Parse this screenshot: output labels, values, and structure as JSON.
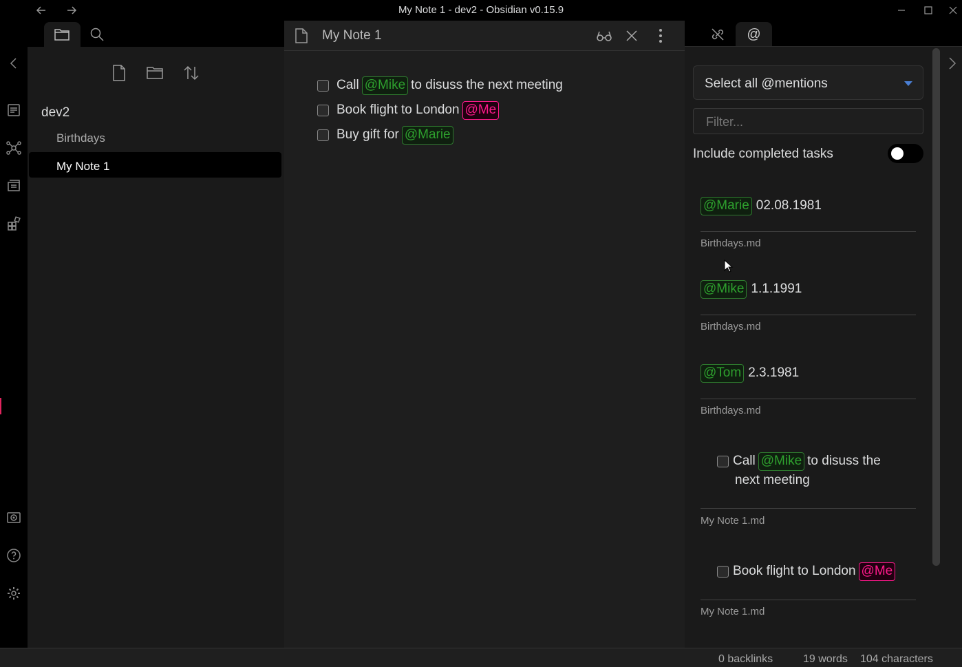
{
  "window": {
    "title": "My Note 1 - dev2 - Obsidian v0.15.9"
  },
  "left_sidebar": {
    "vault": "dev2",
    "items": [
      {
        "label": "Birthdays"
      },
      {
        "label": "My Note 1"
      }
    ]
  },
  "editor": {
    "title": "My Note 1",
    "tasks": [
      {
        "pre": "Call",
        "mention": "@Mike",
        "post": "to disuss the next meeting"
      },
      {
        "pre": "Book flight to London",
        "mention": "@Me",
        "post": ""
      },
      {
        "pre": "Buy gift for",
        "mention": "@Marie",
        "post": ""
      }
    ]
  },
  "mentions_panel": {
    "select_label": "Select all @mentions",
    "filter_placeholder": "Filter...",
    "include_completed_label": "Include completed tasks",
    "include_completed": false,
    "entries": [
      {
        "mention": "@Marie",
        "text": "02.08.1981",
        "source": "Birthdays.md"
      },
      {
        "mention": "@Mike",
        "text": "1.1.1991",
        "source": "Birthdays.md"
      },
      {
        "mention": "@Tom",
        "text": "2.3.1981",
        "source": "Birthdays.md"
      },
      {
        "pre": "Call",
        "mention": "@Mike",
        "post": "to disuss the",
        "line2": "next meeting",
        "source": "My Note 1.md"
      },
      {
        "pre": "Book flight to London",
        "mention": "@Me",
        "post": "",
        "source": "My Note 1.md"
      }
    ]
  },
  "status": {
    "backlinks": "0 backlinks",
    "words": "19 words",
    "characters": "104 characters"
  },
  "colors": {
    "mention_green": "#2ea02e",
    "mention_pink": "#ff1a8c",
    "accent_blue": "#4a7fd4"
  }
}
